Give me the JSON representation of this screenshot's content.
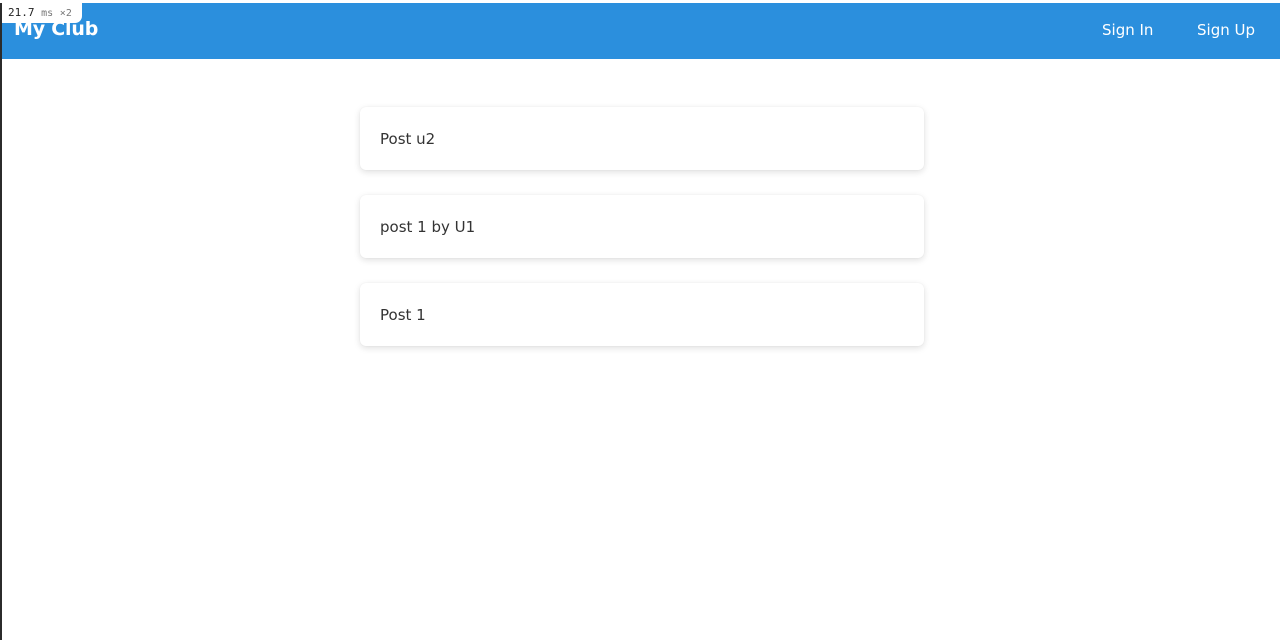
{
  "perf": {
    "value": "21.7",
    "unit": "ms",
    "multiplier": "×2"
  },
  "navbar": {
    "brand": "My Club",
    "links": [
      {
        "label": "Sign In"
      },
      {
        "label": "Sign Up"
      }
    ]
  },
  "posts": [
    {
      "title": "Post u2"
    },
    {
      "title": "post 1 by U1"
    },
    {
      "title": "Post 1"
    }
  ],
  "colors": {
    "navbar_bg": "#2b8fdd",
    "page_bg": "#ffffff",
    "text": "#333333"
  }
}
